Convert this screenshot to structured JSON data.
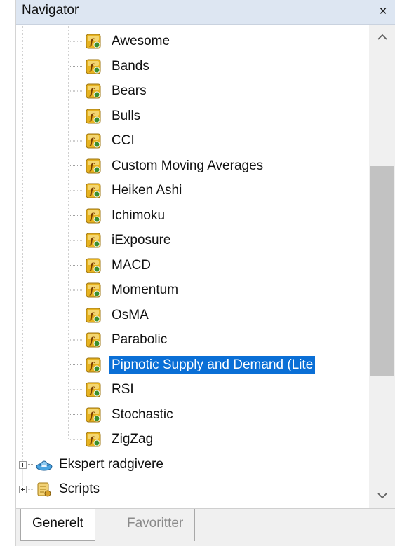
{
  "window": {
    "title": "Navigator",
    "close_label": "×"
  },
  "tree": {
    "indicators": [
      {
        "label": "Awesome",
        "selected": false
      },
      {
        "label": "Bands",
        "selected": false
      },
      {
        "label": "Bears",
        "selected": false
      },
      {
        "label": "Bulls",
        "selected": false
      },
      {
        "label": "CCI",
        "selected": false
      },
      {
        "label": "Custom Moving Averages",
        "selected": false
      },
      {
        "label": "Heiken Ashi",
        "selected": false
      },
      {
        "label": "Ichimoku",
        "selected": false
      },
      {
        "label": "iExposure",
        "selected": false
      },
      {
        "label": "MACD",
        "selected": false
      },
      {
        "label": "Momentum",
        "selected": false
      },
      {
        "label": "OsMA",
        "selected": false
      },
      {
        "label": "Parabolic",
        "selected": false
      },
      {
        "label": "Pipnotic Supply and Demand (Lite",
        "selected": true
      },
      {
        "label": "RSI",
        "selected": false
      },
      {
        "label": "Stochastic",
        "selected": false
      },
      {
        "label": "ZigZag",
        "selected": false
      }
    ],
    "folders": [
      {
        "label": "Ekspert radgivere",
        "icon": "expert-advisors-icon"
      },
      {
        "label": "Scripts",
        "icon": "scripts-icon"
      }
    ]
  },
  "scrollbar": {
    "position_fraction": 0.52,
    "thumb_fraction": 0.48
  },
  "tabs": [
    {
      "label": "Generelt",
      "active": true
    },
    {
      "label": "Favoritter",
      "active": false
    }
  ],
  "colors": {
    "selection": "#0a6fd6",
    "header": "#dde6f2",
    "icon_gold": "#e7b321"
  }
}
